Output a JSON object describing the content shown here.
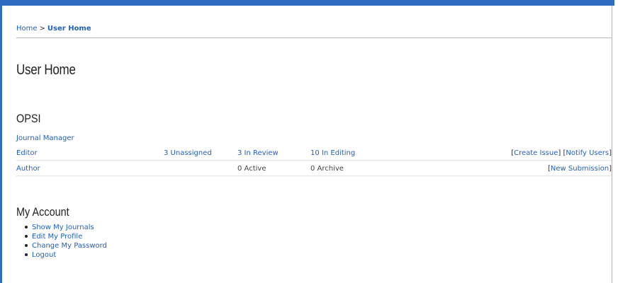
{
  "breadcrumb": {
    "home": "Home",
    "separator": ">",
    "current": "User Home"
  },
  "page_title": "User Home",
  "journal": {
    "title": "OPSI",
    "roles": [
      {
        "name": "Journal Manager"
      },
      {
        "name": "Editor",
        "stat1": "3 Unassigned",
        "stat2": "3 In Review",
        "stat3": "10 In Editing",
        "actions": [
          "Create Issue",
          "Notify Users"
        ]
      },
      {
        "name": "Author",
        "stat2": "0 Active",
        "stat3": "0 Archive",
        "actions": [
          "New Submission"
        ]
      }
    ]
  },
  "account": {
    "title": "My Account",
    "links": [
      "Show My Journals",
      "Edit My Profile",
      "Change My Password",
      "Logout"
    ]
  },
  "colors": {
    "link": "#1f5fbf",
    "frame": "#2e6cc0"
  }
}
